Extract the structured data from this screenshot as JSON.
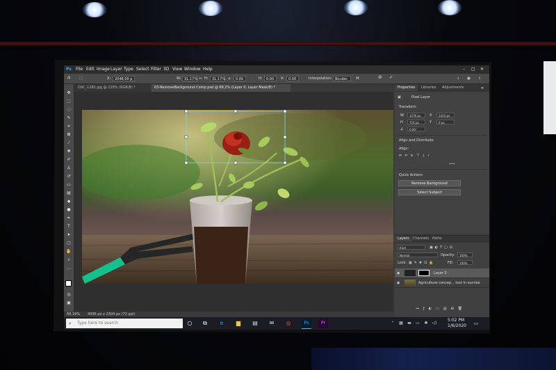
{
  "menu": [
    "File",
    "Edit",
    "Image",
    "Layer",
    "Type",
    "Select",
    "Filter",
    "3D",
    "View",
    "Window",
    "Help"
  ],
  "options": {
    "x_label": "X:",
    "x_value": "2048.00 p",
    "w_label": "W:",
    "w_value": "31.17%",
    "h_label": "H:",
    "h_value": "31.17%",
    "angle_value": "0.00",
    "h2_label": "H:",
    "h2_value": "0.00",
    "v_label": "V:",
    "v_value": "0.00",
    "interp_label": "Interpolation:",
    "interp_value": "Bicubic"
  },
  "tabs": [
    {
      "label": "DSC_1282.jpg @ 218% (RGB/8) *"
    },
    {
      "label": "03-RemoveBackground-Comp.psd @ 68.2% (Layer 0, Layer Mask/8) *"
    }
  ],
  "properties": {
    "tabs": [
      "Properties",
      "Libraries",
      "Adjustments"
    ],
    "pixel_layer": "Pixel Layer",
    "transform_title": "Transform",
    "w_label": "W",
    "w_value": "1276 px",
    "x_label": "X",
    "x_value": "1410 px",
    "h_label": "H",
    "h_value": "716 px",
    "y_label": "Y",
    "y_value": "0 px",
    "angle_value": "0.00°",
    "align_title": "Align and Distribute",
    "align_label": "Align:",
    "quick_title": "Quick Actions",
    "remove_bg": "Remove Background",
    "select_subject": "Select Subject"
  },
  "layers_panel": {
    "tabs": [
      "Layers",
      "Channels",
      "Paths"
    ],
    "kind": "Kind",
    "blend": "Normal",
    "opacity_label": "Opacity:",
    "opacity_value": "100%",
    "lock_label": "Lock:",
    "fill_label": "Fill:",
    "fill_value": "100%",
    "rows": [
      {
        "name": "Layer 0"
      },
      {
        "name": "Agriculture concep... tool in sunrise"
      }
    ]
  },
  "status": {
    "zoom": "68.19%",
    "doc": "4096 px x 2304 px (72 ppi)"
  },
  "taskbar": {
    "search_placeholder": "Type here to search",
    "time": "5:02 PM",
    "date": "1/6/2020",
    "apps": [
      "Ps",
      "Pr"
    ]
  },
  "colors": {
    "accent": "#31a8ff",
    "panel": "#424242",
    "taskbar": "#1c1c24"
  }
}
